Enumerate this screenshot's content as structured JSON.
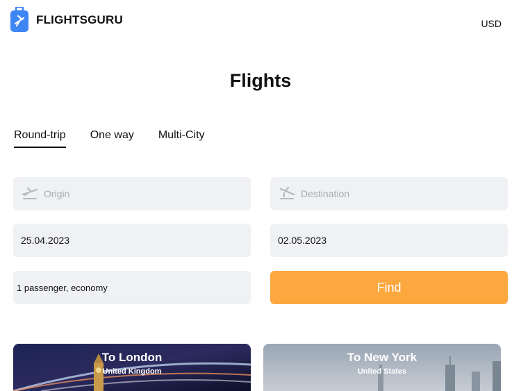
{
  "brand": {
    "name": "FLIGHTSGURU",
    "icon": "luggage-plane-icon",
    "color": "#3f86f5"
  },
  "currency": "USD",
  "title": "Flights",
  "tabs": [
    {
      "label": "Round-trip",
      "active": true
    },
    {
      "label": "One way",
      "active": false
    },
    {
      "label": "Multi-City",
      "active": false
    }
  ],
  "form": {
    "origin_placeholder": "Origin",
    "destination_placeholder": "Destination",
    "depart_date": "25.04.2023",
    "return_date": "02.05.2023",
    "passengers": "1 passenger, economy",
    "find_label": "Find",
    "find_color": "#fda83f"
  },
  "destinations": [
    {
      "title": "To London",
      "subtitle": "United Kingdom"
    },
    {
      "title": "To New York",
      "subtitle": "United States"
    }
  ]
}
